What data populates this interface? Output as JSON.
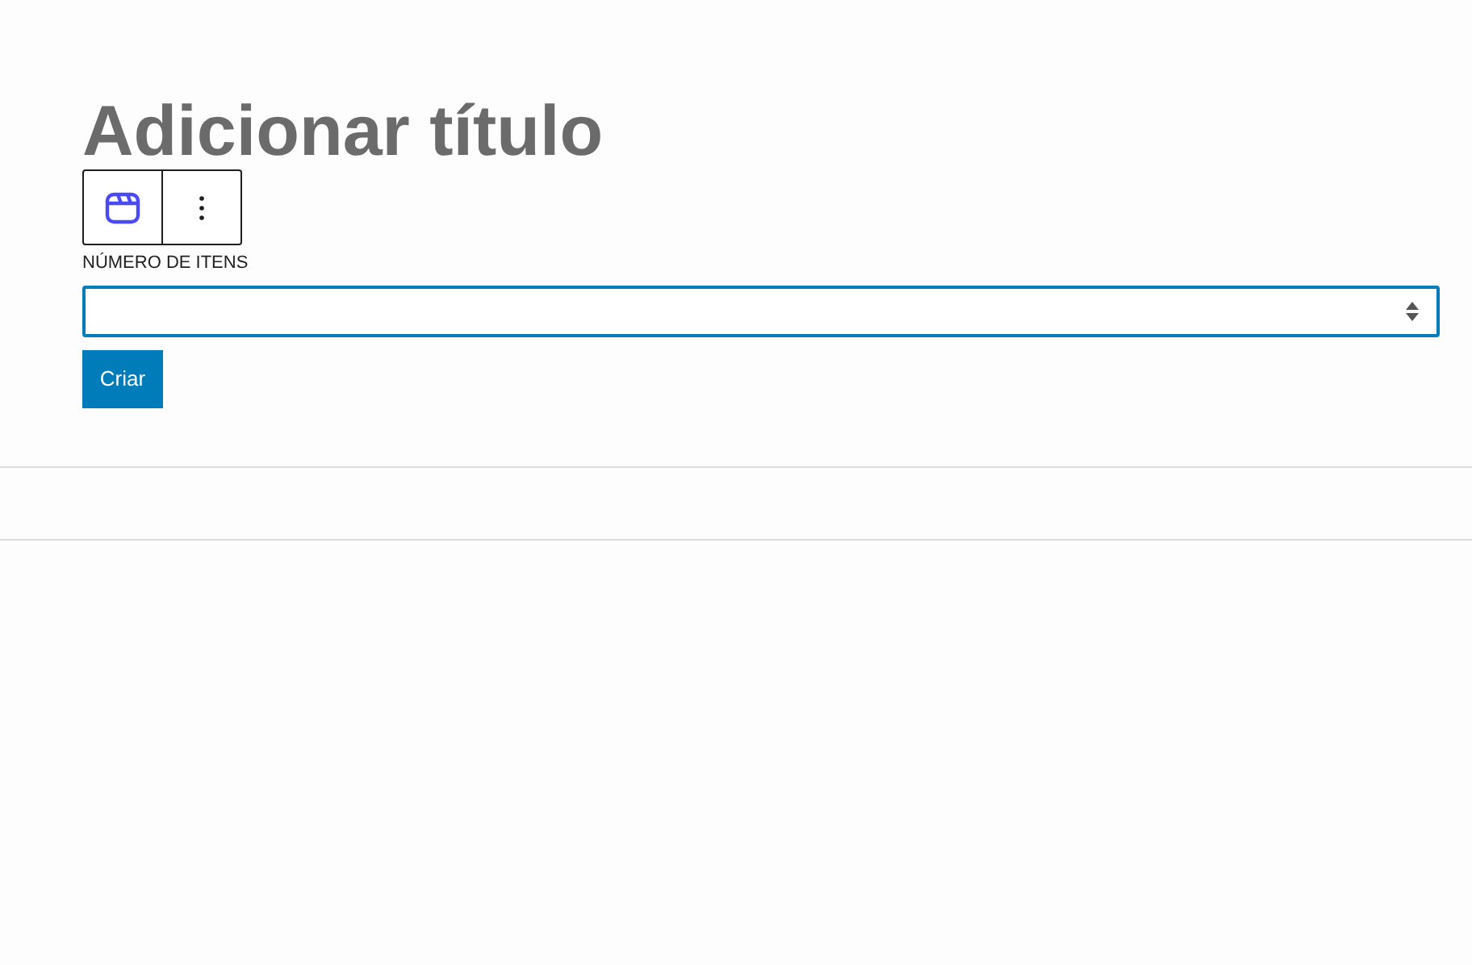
{
  "title": {
    "placeholder": "Adicionar título"
  },
  "field": {
    "label": "NÚMERO DE ITENS",
    "focused": true
  },
  "button": {
    "label": "Criar"
  }
}
